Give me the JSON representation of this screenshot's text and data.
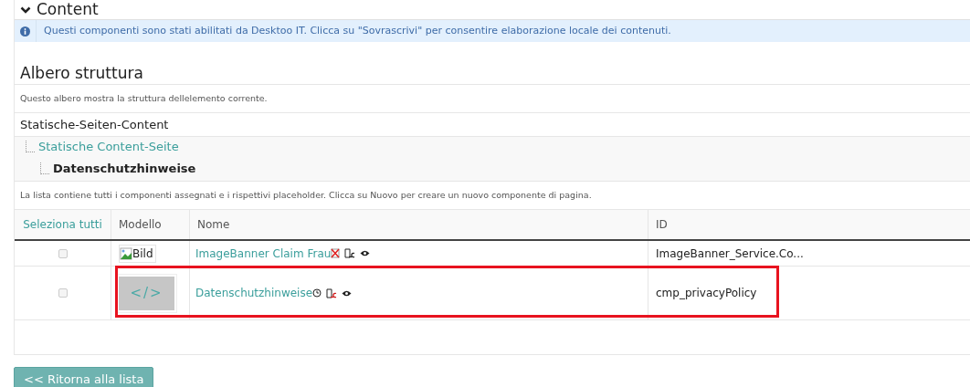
{
  "section": {
    "title": "Content",
    "expanded": true
  },
  "info": "Questi componenti sono stati abilitati da Desktoo IT. Clicca su \"Sovrascrivi\" per consentire elaborazione locale dei contenuti.",
  "tree": {
    "title": "Albero struttura",
    "description": "Questo albero mostra la struttura dellelemento corrente.",
    "nodes": [
      {
        "label": "Statische-Seiten-Content",
        "kind": "root",
        "children": [
          {
            "label": "Statische Content-Seite",
            "kind": "link",
            "children": [
              {
                "label": "Datenschutzhinweise",
                "kind": "current"
              }
            ]
          }
        ]
      }
    ]
  },
  "list_description": "La lista contiene tutti i componenti assegnati e i rispettivi placeholder. Clicca su Nuovo per creare un nuovo componente di pagina.",
  "table": {
    "columns": [
      {
        "label": "Seleziona tutti",
        "kind": "link"
      },
      {
        "label": "Modello",
        "kind": "text"
      },
      {
        "label": "Nome",
        "kind": "text"
      },
      {
        "label": "ID",
        "kind": "text"
      }
    ],
    "rows": [
      {
        "checked": false,
        "model": {
          "kind": "broken-image",
          "text": "Bild"
        },
        "name": "ImageBanner Claim Frau",
        "icons": [
          {
            "kind": "cross"
          },
          {
            "kind": "page"
          },
          {
            "kind": "eye"
          }
        ],
        "id": "ImageBanner_Service.Co...",
        "highlighted": false
      },
      {
        "checked": false,
        "model": {
          "kind": "code",
          "text": "</>"
        },
        "name": "Datenschutzhinweise",
        "icons": [
          {
            "kind": "clock"
          },
          {
            "kind": "pagered"
          },
          {
            "kind": "eye"
          }
        ],
        "id": "cmp_privacyPolicy",
        "highlighted": true
      }
    ]
  },
  "back_button": "<< Ritorna alla lista"
}
